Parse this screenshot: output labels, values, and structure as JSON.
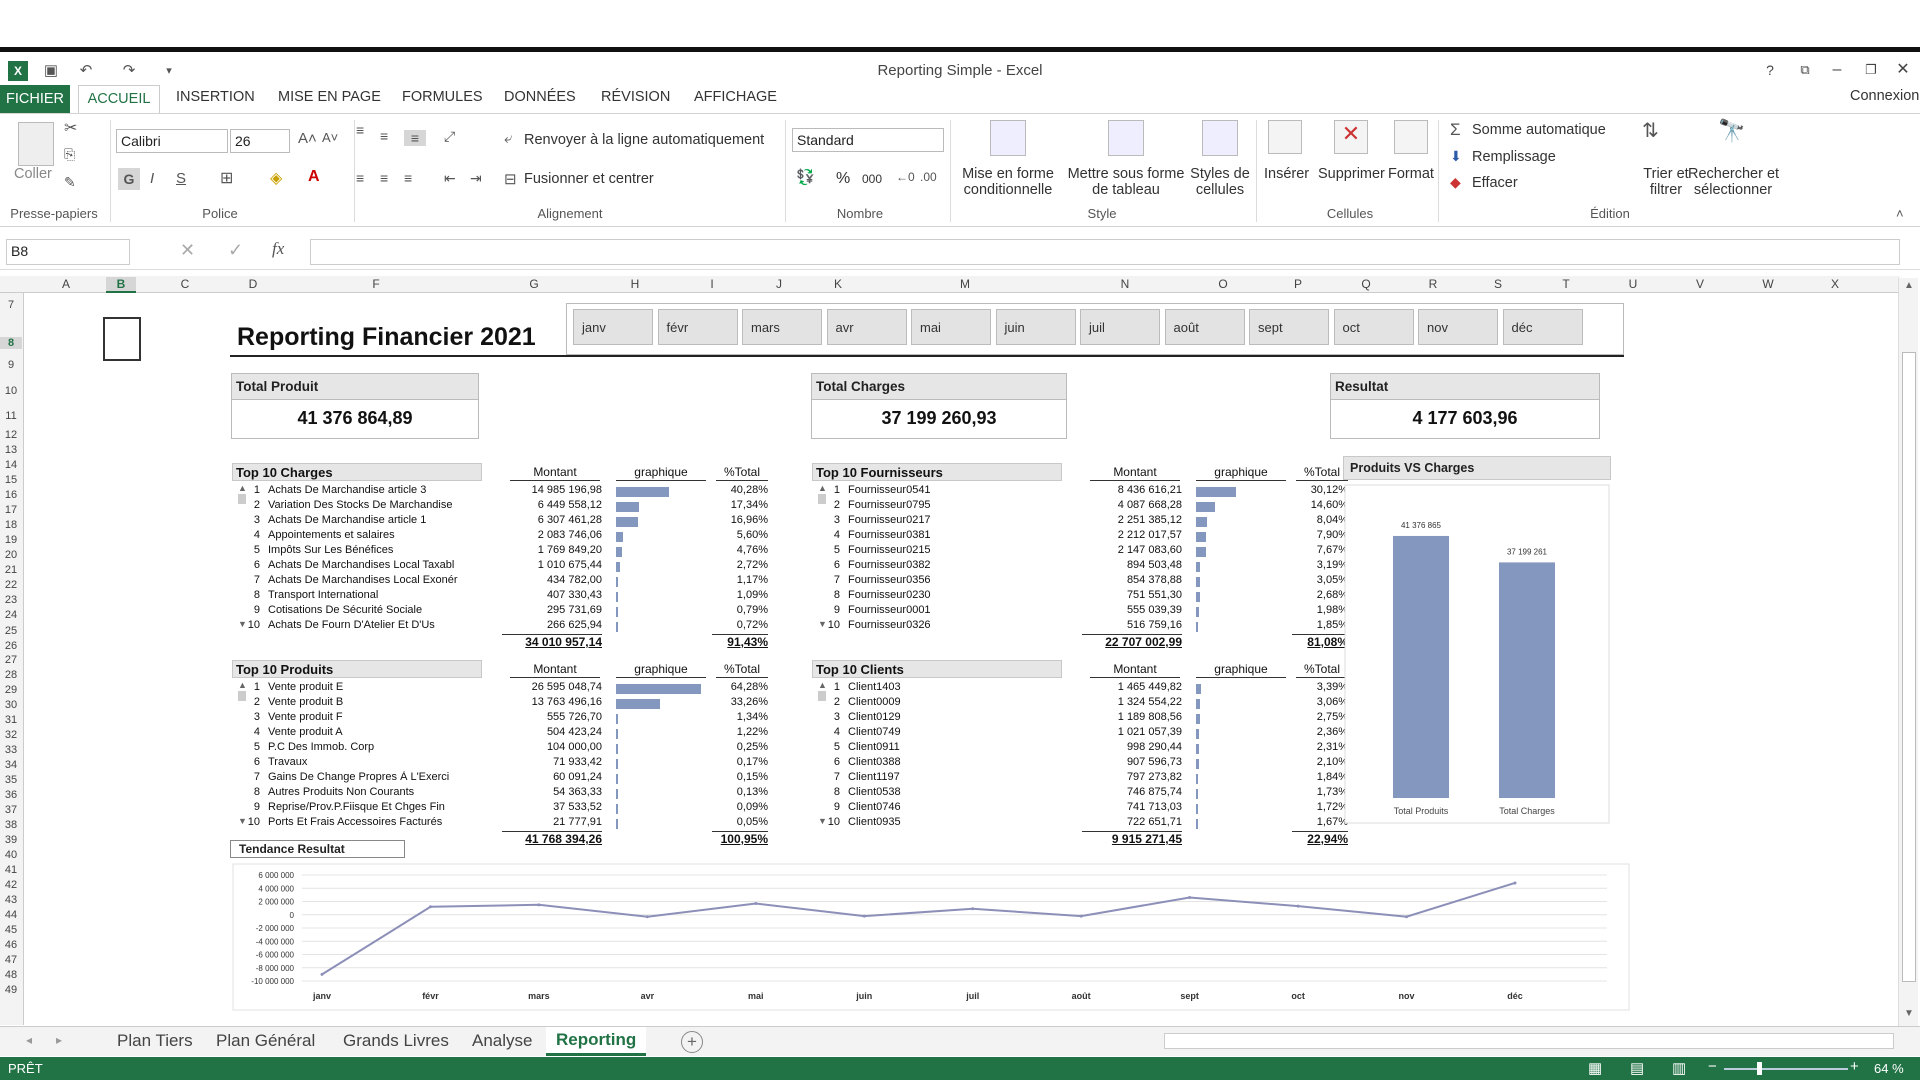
{
  "window": {
    "title": "Reporting Simple - Excel",
    "help": "?",
    "signin": "Connexion"
  },
  "ribbon_tabs": [
    "FICHIER",
    "ACCUEIL",
    "INSERTION",
    "MISE EN PAGE",
    "FORMULES",
    "DONNÉES",
    "RÉVISION",
    "AFFICHAGE"
  ],
  "clipboard": {
    "paste": "Coller",
    "group": "Presse-papiers"
  },
  "font": {
    "name": "Calibri",
    "size": "26",
    "bold": "G",
    "italic": "I",
    "underline": "S",
    "group": "Police"
  },
  "alignment": {
    "wrap": "Renvoyer à la ligne automatiquement",
    "merge": "Fusionner et centrer",
    "group": "Alignement"
  },
  "number": {
    "format": "Standard",
    "percent": "%",
    "thousands": "000",
    "group": "Nombre"
  },
  "style": {
    "cond1": "Mise en forme",
    "cond2": "conditionnelle",
    "table1": "Mettre sous forme",
    "table2": "de tableau",
    "cell1": "Styles de",
    "cell2": "cellules",
    "group": "Style"
  },
  "cells": {
    "insert": "Insérer",
    "delete": "Supprimer",
    "format": "Format",
    "group": "Cellules"
  },
  "editing": {
    "autosum": "Somme automatique",
    "fill": "Remplissage",
    "clear": "Effacer",
    "sort1": "Trier et",
    "sort2": "filtrer",
    "find1": "Rechercher et",
    "find2": "sélectionner",
    "group": "Édition"
  },
  "formula_bar": {
    "name_box": "B8",
    "fx": "fx",
    "value": ""
  },
  "columns": [
    "A",
    "B",
    "C",
    "D",
    "F",
    "G",
    "H",
    "I",
    "J",
    "K",
    "M",
    "N",
    "O",
    "P",
    "Q",
    "R",
    "S",
    "T",
    "U",
    "V",
    "W",
    "X"
  ],
  "rows": [
    "7",
    "8",
    "9",
    "10",
    "11",
    "12",
    "13",
    "14",
    "15",
    "16",
    "17",
    "18",
    "19",
    "20",
    "21",
    "22",
    "23",
    "24",
    "25",
    "26",
    "27",
    "28",
    "29",
    "30",
    "31",
    "32",
    "33",
    "34",
    "35",
    "36",
    "37",
    "38",
    "39",
    "40",
    "41",
    "42",
    "43",
    "44",
    "45",
    "46",
    "47",
    "48",
    "49"
  ],
  "report": {
    "title": "Reporting Financier  2021",
    "months": [
      "janv",
      "févr",
      "mars",
      "avr",
      "mai",
      "juin",
      "juil",
      "août",
      "sept",
      "oct",
      "nov",
      "déc"
    ],
    "kpis": [
      {
        "label": "Total Produit",
        "value": "41 376 864,89"
      },
      {
        "label": "Total Charges",
        "value": "37 199 260,93"
      },
      {
        "label": "Resultat",
        "value": "4 177 603,96"
      }
    ],
    "col_montant": "Montant",
    "col_graph": "graphique",
    "col_pct": "%Total",
    "top_charges": {
      "title": "Top 10 Charges",
      "total": "34 010 957,14",
      "total_pct": "91,43%",
      "rows": [
        {
          "n": "1",
          "label": "Achats De Marchandise article 3",
          "amount": "14 985 196,98",
          "pct": "40,28%",
          "share": 40.28
        },
        {
          "n": "2",
          "label": "Variation Des Stocks De Marchandise",
          "amount": "6 449 558,12",
          "pct": "17,34%",
          "share": 17.34
        },
        {
          "n": "3",
          "label": "Achats De Marchandise article 1",
          "amount": "6 307 461,28",
          "pct": "16,96%",
          "share": 16.96
        },
        {
          "n": "4",
          "label": "Appointements et salaires",
          "amount": "2 083 746,06",
          "pct": "5,60%",
          "share": 5.6
        },
        {
          "n": "5",
          "label": "Impôts Sur Les Bénéfices",
          "amount": "1 769 849,20",
          "pct": "4,76%",
          "share": 4.76
        },
        {
          "n": "6",
          "label": "Achats De Marchandises Local Taxabl",
          "amount": "1 010 675,44",
          "pct": "2,72%",
          "share": 2.72
        },
        {
          "n": "7",
          "label": "Achats De Marchandises Local Exonér",
          "amount": "434 782,00",
          "pct": "1,17%",
          "share": 1.17
        },
        {
          "n": "8",
          "label": "Transport International",
          "amount": "407 330,43",
          "pct": "1,09%",
          "share": 1.09
        },
        {
          "n": "9",
          "label": "Cotisations De Sécurité Sociale",
          "amount": "295 731,69",
          "pct": "0,79%",
          "share": 0.79
        },
        {
          "n": "10",
          "label": "Achats De Fourn D'Atelier Et D'Us",
          "amount": "266 625,94",
          "pct": "0,72%",
          "share": 0.72
        }
      ]
    },
    "top_produits": {
      "title": "Top 10 Produits",
      "total": "41 768 394,26",
      "total_pct": "100,95%",
      "rows": [
        {
          "n": "1",
          "label": "Vente produit  E",
          "amount": "26 595 048,74",
          "pct": "64,28%",
          "share": 64.28
        },
        {
          "n": "2",
          "label": "Vente produit  B",
          "amount": "13 763 496,16",
          "pct": "33,26%",
          "share": 33.26
        },
        {
          "n": "3",
          "label": "Vente produit F",
          "amount": "555 726,70",
          "pct": "1,34%",
          "share": 1.34
        },
        {
          "n": "4",
          "label": "Vente produit A",
          "amount": "504 423,24",
          "pct": "1,22%",
          "share": 1.22
        },
        {
          "n": "5",
          "label": "P.C Des Immob. Corp",
          "amount": "104 000,00",
          "pct": "0,25%",
          "share": 0.25
        },
        {
          "n": "6",
          "label": "Travaux",
          "amount": "71 933,42",
          "pct": "0,17%",
          "share": 0.17
        },
        {
          "n": "7",
          "label": "Gains De Change Propres À L'Exerci",
          "amount": "60 091,24",
          "pct": "0,15%",
          "share": 0.15
        },
        {
          "n": "8",
          "label": "Autres Produits  Non Courants",
          "amount": "54 363,33",
          "pct": "0,13%",
          "share": 0.13
        },
        {
          "n": "9",
          "label": "Reprise/Prov.P.Fiisque Et Chges Fin",
          "amount": "37 533,52",
          "pct": "0,09%",
          "share": 0.09
        },
        {
          "n": "10",
          "label": "Ports Et Frais Accessoires Facturés",
          "amount": "21 777,91",
          "pct": "0,05%",
          "share": 0.05
        }
      ]
    },
    "top_fournisseurs": {
      "title": "Top 10 Fournisseurs",
      "total": "22 707 002,99",
      "total_pct": "81,08%",
      "rows": [
        {
          "n": "1",
          "label": "Fournisseur0541",
          "amount": "8 436 616,21",
          "pct": "30,12%",
          "share": 30.12
        },
        {
          "n": "2",
          "label": "Fournisseur0795",
          "amount": "4 087 668,28",
          "pct": "14,60%",
          "share": 14.6
        },
        {
          "n": "3",
          "label": "Fournisseur0217",
          "amount": "2 251 385,12",
          "pct": "8,04%",
          "share": 8.04
        },
        {
          "n": "4",
          "label": "Fournisseur0381",
          "amount": "2 212 017,57",
          "pct": "7,90%",
          "share": 7.9
        },
        {
          "n": "5",
          "label": "Fournisseur0215",
          "amount": "2 147 083,60",
          "pct": "7,67%",
          "share": 7.67
        },
        {
          "n": "6",
          "label": "Fournisseur0382",
          "amount": "894 503,48",
          "pct": "3,19%",
          "share": 3.19
        },
        {
          "n": "7",
          "label": "Fournisseur0356",
          "amount": "854 378,88",
          "pct": "3,05%",
          "share": 3.05
        },
        {
          "n": "8",
          "label": "Fournisseur0230",
          "amount": "751 551,30",
          "pct": "2,68%",
          "share": 2.68
        },
        {
          "n": "9",
          "label": "Fournisseur0001",
          "amount": "555 039,39",
          "pct": "1,98%",
          "share": 1.98
        },
        {
          "n": "10",
          "label": "Fournisseur0326",
          "amount": "516 759,16",
          "pct": "1,85%",
          "share": 1.85
        }
      ]
    },
    "top_clients": {
      "title": "Top 10 Clients",
      "total": "9 915 271,45",
      "total_pct": "22,94%",
      "rows": [
        {
          "n": "1",
          "label": "Client1403",
          "amount": "1 465 449,82",
          "pct": "3,39%",
          "share": 3.39
        },
        {
          "n": "2",
          "label": "Client0009",
          "amount": "1 324 554,22",
          "pct": "3,06%",
          "share": 3.06
        },
        {
          "n": "3",
          "label": "Client0129",
          "amount": "1 189 808,56",
          "pct": "2,75%",
          "share": 2.75
        },
        {
          "n": "4",
          "label": "Client0749",
          "amount": "1 021 057,39",
          "pct": "2,36%",
          "share": 2.36
        },
        {
          "n": "5",
          "label": "Client0911",
          "amount": "998 290,44",
          "pct": "2,31%",
          "share": 2.31
        },
        {
          "n": "6",
          "label": "Client0388",
          "amount": "907 596,73",
          "pct": "2,10%",
          "share": 2.1
        },
        {
          "n": "7",
          "label": "Client1197",
          "amount": "797 273,82",
          "pct": "1,84%",
          "share": 1.84
        },
        {
          "n": "8",
          "label": "Client0538",
          "amount": "746 875,74",
          "pct": "1,73%",
          "share": 1.73
        },
        {
          "n": "9",
          "label": "Client0746",
          "amount": "741 713,03",
          "pct": "1,72%",
          "share": 1.72
        },
        {
          "n": "10",
          "label": "Client0935",
          "amount": "722 651,71",
          "pct": "1,67%",
          "share": 1.67
        }
      ]
    }
  },
  "chart_data": [
    {
      "type": "bar",
      "title": "Produits  VS  Charges",
      "categories": [
        "Total Produits",
        "Total Charges"
      ],
      "values": [
        41376865,
        37199261
      ],
      "data_labels": [
        "41 376 865",
        "37 199 261"
      ],
      "ylim": [
        0,
        45000000
      ],
      "grid": false,
      "color": "#8497bf"
    },
    {
      "type": "line",
      "title": "Tendance  Resultat",
      "categories": [
        "janv",
        "févr",
        "mars",
        "avr",
        "mai",
        "juin",
        "juil",
        "août",
        "sept",
        "oct",
        "nov",
        "déc"
      ],
      "values": [
        -9000000,
        1200000,
        1500000,
        -300000,
        1700000,
        -200000,
        900000,
        -200000,
        2600000,
        1300000,
        -300000,
        4800000
      ],
      "yticks": [
        "6 000 000",
        "4 000 000",
        "2 000 000",
        "0",
        "-2 000 000",
        "-4 000 000",
        "-6 000 000",
        "-8 000 000",
        "-10 000 000"
      ],
      "ylim": [
        -10000000,
        6000000
      ],
      "grid": true,
      "color": "#8c8fb8"
    }
  ],
  "sheet_tabs": [
    "Plan Tiers",
    "Plan Général",
    "Grands Livres",
    "Analyse",
    "Reporting"
  ],
  "status": {
    "ready": "PRÊT",
    "zoom": "64 %"
  }
}
